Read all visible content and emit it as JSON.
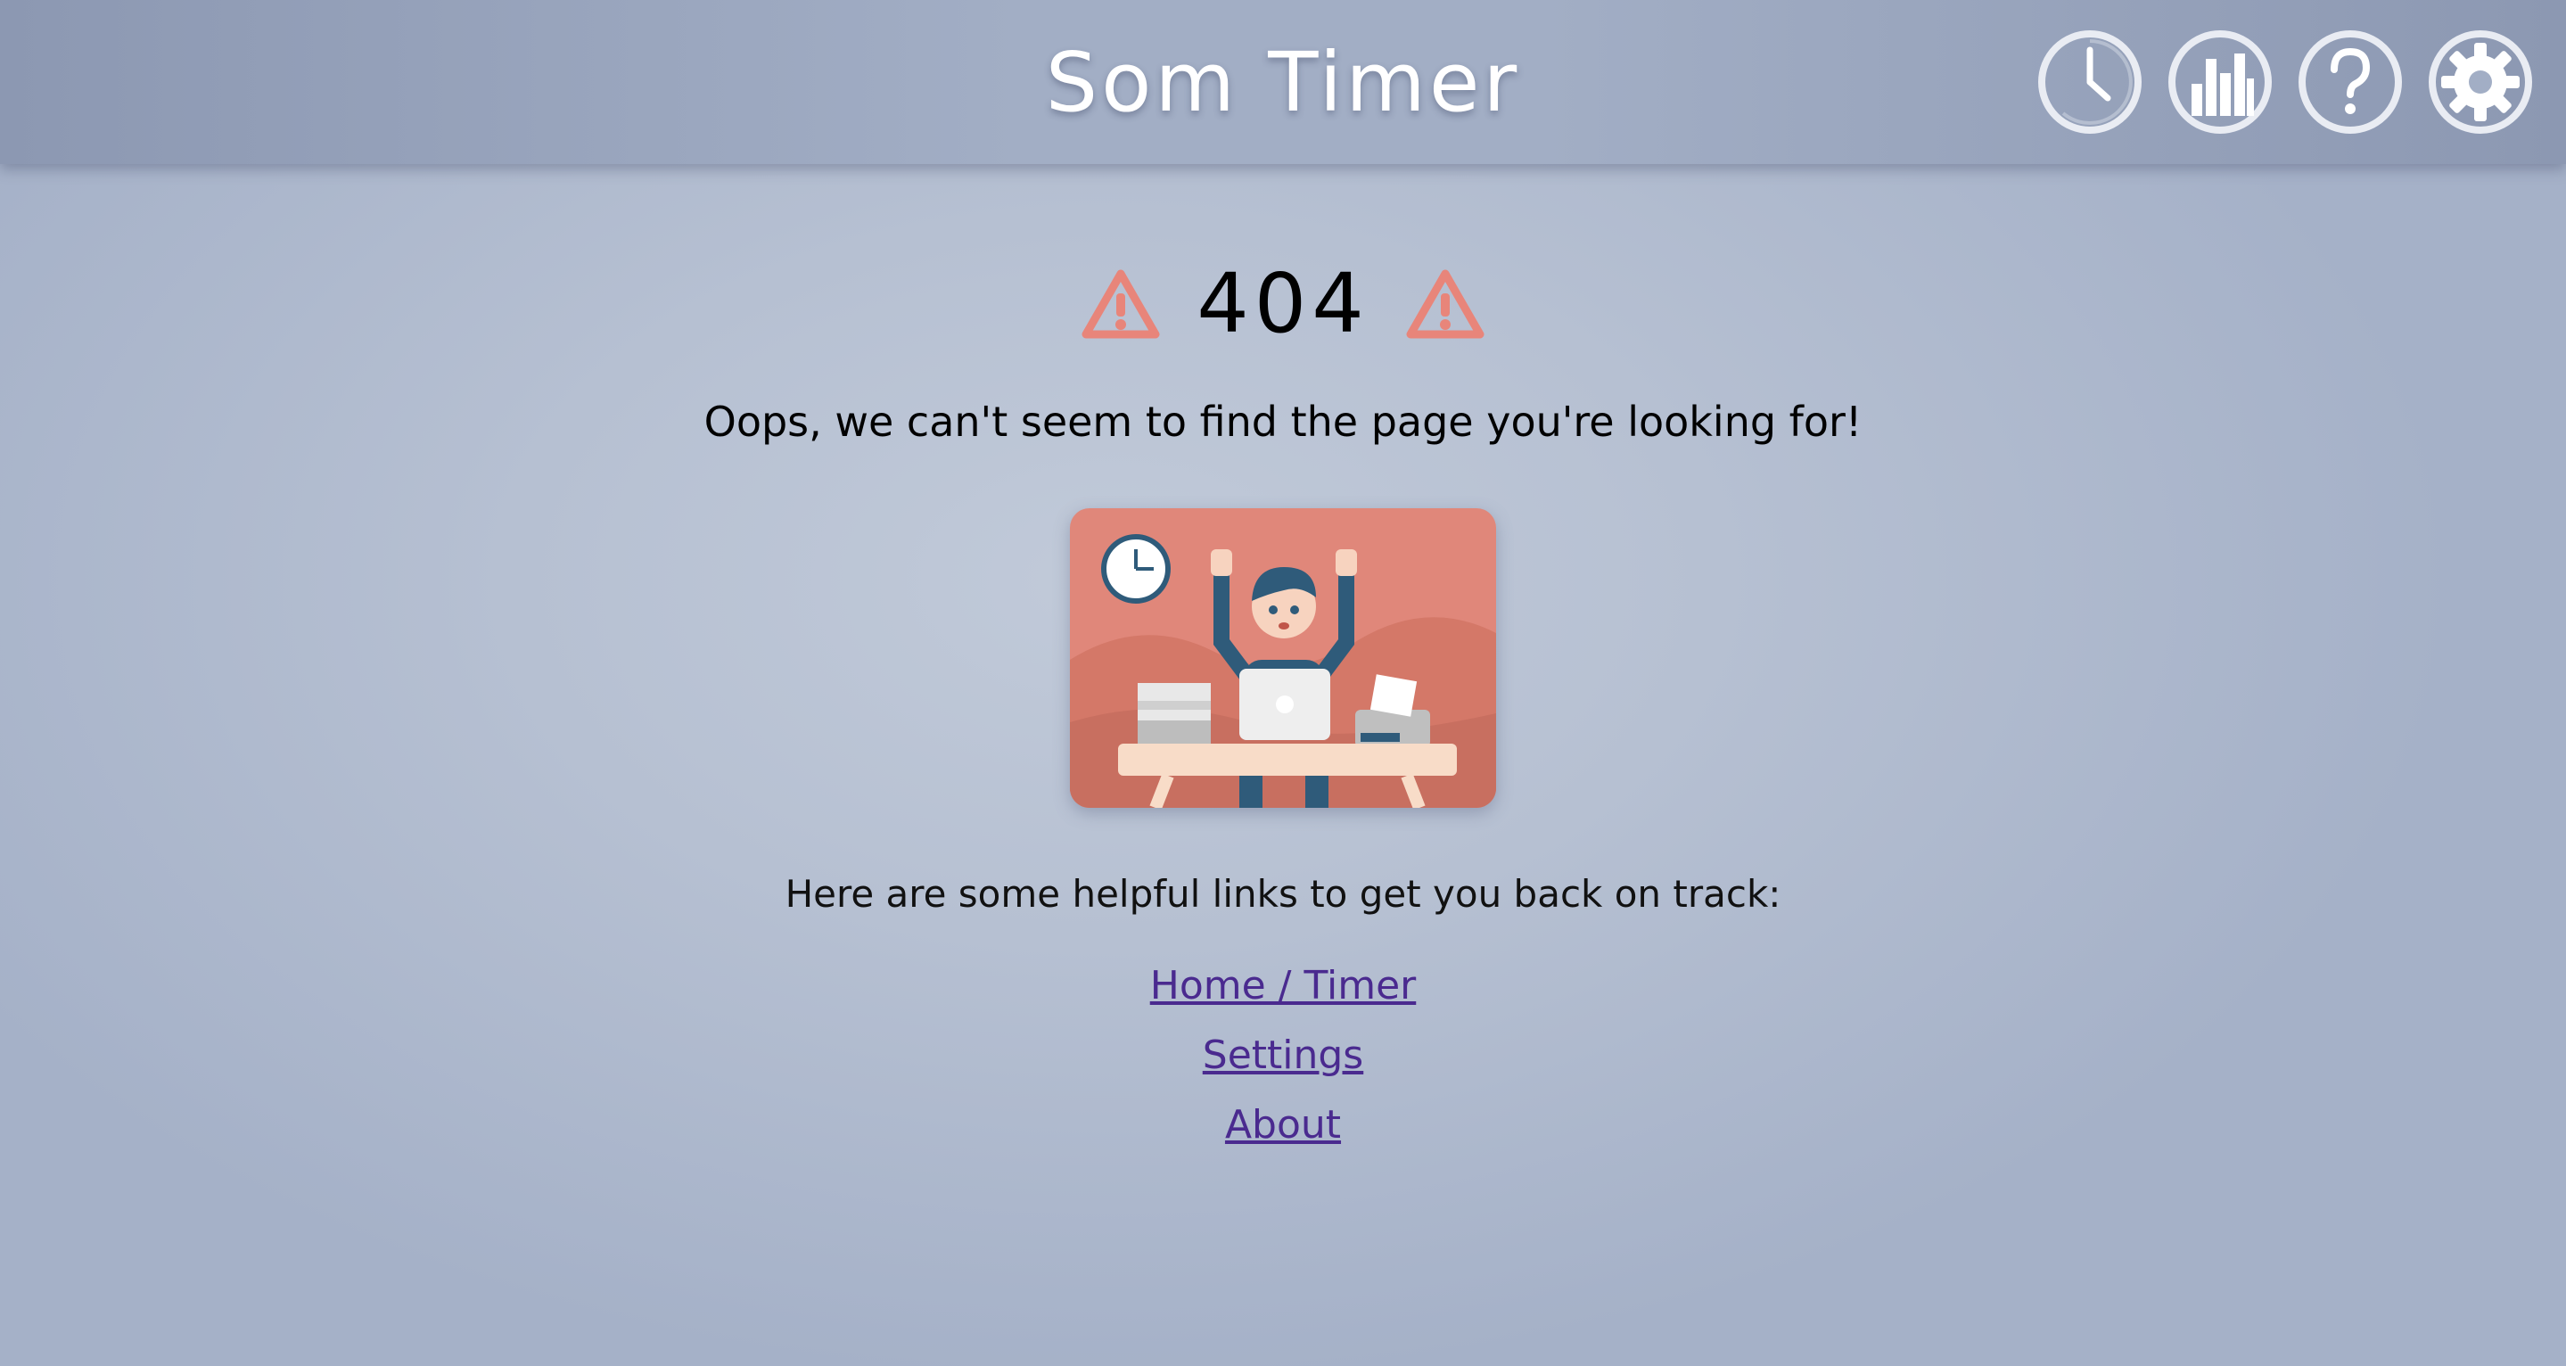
{
  "header": {
    "title": "Som Timer",
    "nav": [
      {
        "name": "timer-icon"
      },
      {
        "name": "statistics-icon"
      },
      {
        "name": "help-icon"
      },
      {
        "name": "settings-icon"
      }
    ]
  },
  "error": {
    "code": "404",
    "message": "Oops, we can't seem to find the page you're looking for!",
    "icon": "warning-icon",
    "icon_color": "#e8857a"
  },
  "illustration": {
    "description_icon": "stressed-worker-illustration",
    "bg_color": "#e0877a"
  },
  "help": {
    "text": "Here are some helpful links to get you back on track:",
    "links": [
      {
        "label": "Home / Timer"
      },
      {
        "label": "Settings"
      },
      {
        "label": "About"
      }
    ]
  },
  "colors": {
    "link": "#4a2a8f",
    "header_bg": "#9aa6bf",
    "page_bg": "#b9c2d4"
  }
}
